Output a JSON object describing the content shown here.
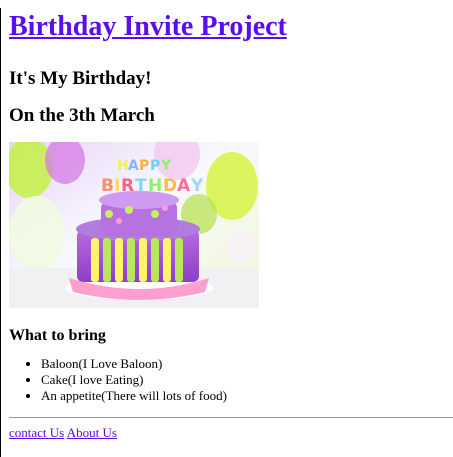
{
  "header": {
    "title": "Birthday Invite Project",
    "subtitle": "It's My Birthday!",
    "date_line": "On the 3th March"
  },
  "image": {
    "alt": "Happy Birthday cake",
    "cake_topper": "HAPPY BIRTHDAY"
  },
  "bring": {
    "heading": "What to bring",
    "items": [
      "Baloon(I Love Baloon)",
      "Cake(I love Eating)",
      "An appetite(There will lots of food)"
    ]
  },
  "footer": {
    "links": [
      "contact Us",
      "About Us"
    ]
  },
  "colors": {
    "link": "#5a0df0",
    "divider": "#9a9a9a"
  }
}
